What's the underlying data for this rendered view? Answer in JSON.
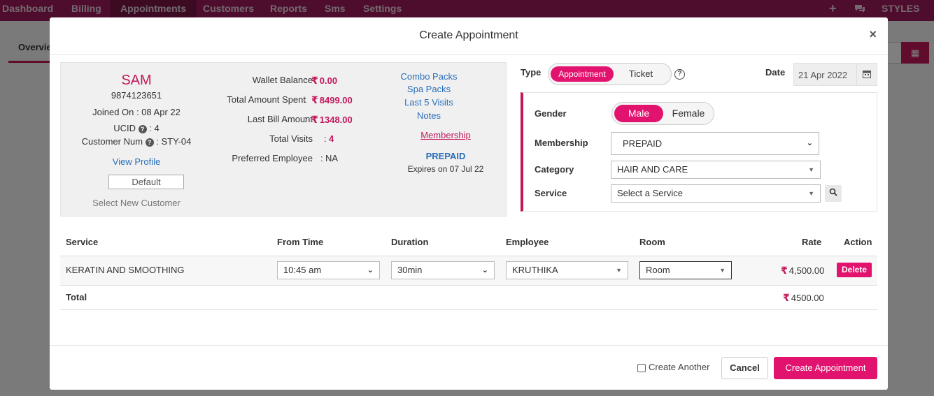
{
  "topnav": {
    "items": [
      "Dashboard",
      "Billing",
      "Appointments",
      "Customers",
      "Reports",
      "Sms",
      "Settings"
    ],
    "active": "Appointments",
    "plus_icon": "+",
    "chat_icon": "chat-icon",
    "brand": "STYLES"
  },
  "page": {
    "tab_label": "Overview"
  },
  "modal": {
    "title": "Create Appointment",
    "close_symbol": "×",
    "customer": {
      "name": "SAM",
      "phone": "9874123651",
      "joined": "Joined On : 08 Apr 22",
      "ucid_label": "UCID",
      "ucid_value": ": 4",
      "cust_num_label": "Customer Num",
      "cust_num_value": ": STY-04",
      "view_profile": "View Profile",
      "default_label": "Default",
      "select_new": "Select New Customer",
      "stats": [
        {
          "label": "Wallet Balance",
          "value": "0.00",
          "rupee": true
        },
        {
          "label": "Total Amount Spent",
          "value": "8499.00",
          "rupee": true
        },
        {
          "label": "Last Bill Amount",
          "value": "1348.00",
          "rupee": true
        },
        {
          "label": "Total Visits",
          "value": "4",
          "rupee": false
        },
        {
          "label": "Preferred Employee",
          "value": "NA",
          "rupee": false
        }
      ],
      "links": [
        "Combo Packs",
        "Spa Packs",
        "Last 5 Visits",
        "Notes"
      ],
      "membership_link": "Membership",
      "membership_type": "PREPAID",
      "membership_expiry": "Expires on 07 Jul 22"
    },
    "form": {
      "type_label": "Type",
      "type_options": [
        "Appointment",
        "Ticket"
      ],
      "type_selected": "Appointment",
      "date_label": "Date",
      "date_value": "21 Apr 2022",
      "gender_label": "Gender",
      "gender_options": [
        "Male",
        "Female"
      ],
      "gender_selected": "Male",
      "membership_label": "Membership",
      "membership_value": "PREPAID",
      "category_label": "Category",
      "category_value": "HAIR AND CARE",
      "service_label": "Service",
      "service_placeholder": "Select a Service"
    },
    "table": {
      "headers": [
        "Service",
        "From Time",
        "Duration",
        "Employee",
        "Room",
        "Rate",
        "Action"
      ],
      "rows": [
        {
          "service": "KERATIN AND SMOOTHING",
          "from_time": "10:45 am",
          "duration": "30min",
          "employee": "KRUTHIKA",
          "room": "Room",
          "rate": "4,500.00",
          "action": "Delete"
        }
      ],
      "total_label": "Total",
      "total_value": "4500.00"
    },
    "footer": {
      "create_another": "Create Another",
      "cancel": "Cancel",
      "create": "Create Appointment"
    }
  },
  "colors": {
    "brand": "#c2185b",
    "accent": "#e2136e",
    "nav": "#9e1a5a",
    "link": "#2a6ebb"
  }
}
